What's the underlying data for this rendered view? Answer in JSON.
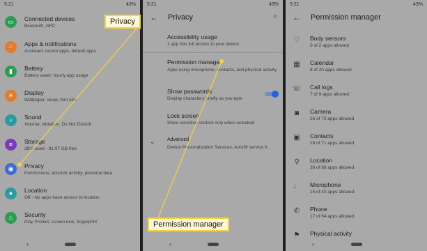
{
  "status": {
    "time": "5:21",
    "icons": "54°",
    "battery": "43%"
  },
  "panel1": {
    "items": [
      {
        "title": "Connected devices",
        "sub": "Bluetooth, NFC",
        "icon": "link-icon",
        "color": "#2e9b52",
        "glyph": "▭"
      },
      {
        "title": "Apps & notifications",
        "sub": "Assistant, recent apps, default apps",
        "icon": "apps-icon",
        "color": "#e57a2b",
        "glyph": "⁙"
      },
      {
        "title": "Battery",
        "sub": "Battery saver, hourly app usage",
        "icon": "battery-icon",
        "color": "#2e9b52",
        "glyph": "▮"
      },
      {
        "title": "Display",
        "sub": "Wallpaper, sleep, font size",
        "icon": "display-icon",
        "color": "#e57a2b",
        "glyph": "☀"
      },
      {
        "title": "Sound",
        "sub": "Volume, vibration, Do Not Disturb",
        "icon": "sound-icon",
        "color": "#2b9aa1",
        "glyph": "♪"
      },
      {
        "title": "Storage",
        "sub": "28% used - 91.97 GB free",
        "icon": "storage-icon",
        "color": "#7a3bb8",
        "glyph": "≡"
      },
      {
        "title": "Privacy",
        "sub": "Permissions, account activity, personal data",
        "icon": "privacy-icon",
        "color": "#3e6ad6",
        "glyph": "◉"
      },
      {
        "title": "Location",
        "sub": "Off - No apps have access to location",
        "icon": "location-icon",
        "color": "#2b9aa1",
        "glyph": "●"
      },
      {
        "title": "Security",
        "sub": "Play Protect, screen lock, fingerprint",
        "icon": "security-icon",
        "color": "#2e9b52",
        "glyph": "⌂"
      }
    ]
  },
  "panel2": {
    "title": "Privacy",
    "items": [
      {
        "title": "Accessibility usage",
        "sub": "1 app has full access to your device"
      },
      {
        "title": "Permission manager",
        "sub": "Apps using microphone, contacts, and physical activity"
      },
      {
        "title": "Show passwords",
        "sub": "Display characters briefly as you type"
      },
      {
        "title": "Lock screen",
        "sub": "Show sensitive content only when unlocked"
      },
      {
        "title": "Advanced",
        "sub": "Device Personalization Services, Autofill service fr..."
      }
    ],
    "show_passwords_on": true
  },
  "panel3": {
    "title": "Permission manager",
    "items": [
      {
        "title": "Body sensors",
        "sub": "0 of 2 apps allowed",
        "icon": "heart-icon",
        "glyph": "♡"
      },
      {
        "title": "Calendar",
        "sub": "8 of 20 apps allowed",
        "icon": "calendar-icon",
        "glyph": "▦"
      },
      {
        "title": "Call logs",
        "sub": "7 of 9 apps allowed",
        "icon": "call-log-icon",
        "glyph": "☏"
      },
      {
        "title": "Camera",
        "sub": "26 of 73 apps allowed",
        "icon": "camera-icon",
        "glyph": "◙"
      },
      {
        "title": "Contacts",
        "sub": "29 of 71 apps allowed",
        "icon": "contacts-icon",
        "glyph": "▣"
      },
      {
        "title": "Location",
        "sub": "38 of 88 apps allowed",
        "icon": "location-icon",
        "glyph": "⚲"
      },
      {
        "title": "Microphone",
        "sub": "15 of 40 apps allowed",
        "icon": "microphone-icon",
        "glyph": "♩"
      },
      {
        "title": "Phone",
        "sub": "17 of 64 apps allowed",
        "icon": "phone-icon",
        "glyph": "✆"
      },
      {
        "title": "Physical activity",
        "sub": "",
        "icon": "activity-icon",
        "glyph": "⚑"
      }
    ]
  },
  "callouts": {
    "privacy": "Privacy",
    "permission_manager": "Permission manager"
  }
}
